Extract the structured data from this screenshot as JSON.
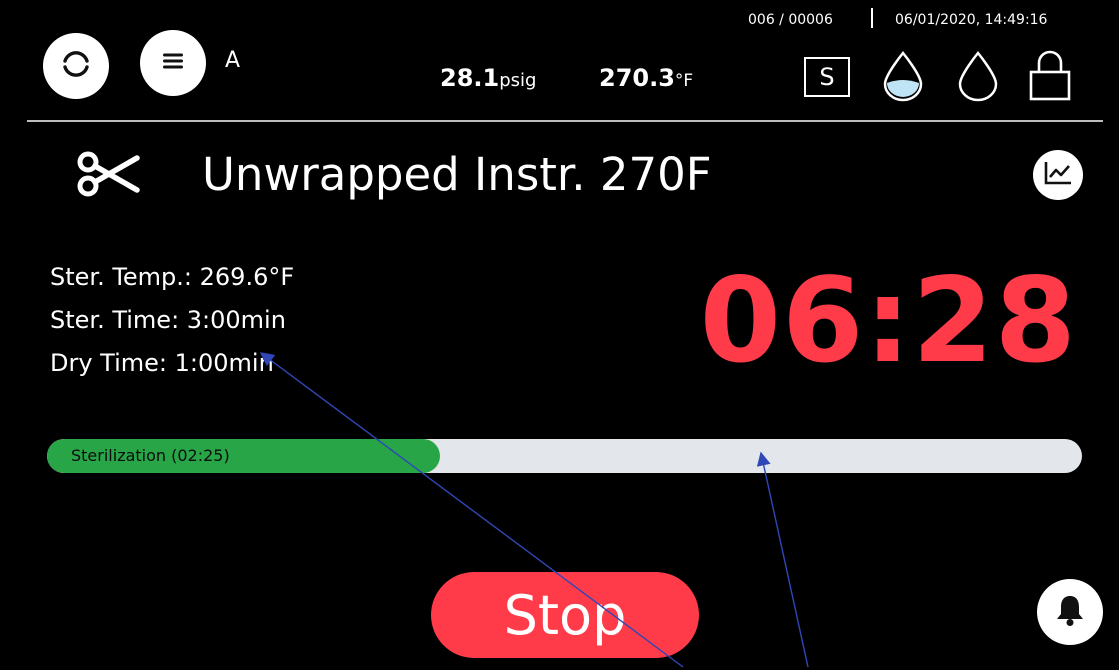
{
  "header": {
    "user_label": "A",
    "pressure_value": "28.1",
    "pressure_unit": "psig",
    "temperature_value": "270.3",
    "temperature_unit": "°F",
    "cycle_counter": "006 / 00006",
    "datetime": "06/01/2020, 14:49:16",
    "status_s_label": "S",
    "icons": {
      "refresh": "refresh-icon",
      "menu": "menu-icon",
      "water_filled": "water-drop-filled-icon",
      "water_empty": "water-drop-empty-icon",
      "lock": "lock-icon"
    }
  },
  "program": {
    "icon": "scissors-icon",
    "title": "Unwrapped Instr. 270F"
  },
  "parameters": {
    "ster_temp": "Ster. Temp.: 269.6°F",
    "ster_time": "Ster. Time: 3:00min",
    "dry_time": "Dry Time: 1:00min"
  },
  "countdown": "06:28",
  "progress": {
    "label": "Sterilization (02:25)",
    "fraction": 0.38
  },
  "actions": {
    "stop_label": "Stop"
  },
  "colors": {
    "background": "#000000",
    "accent_red": "#ff3b4a",
    "progress_green": "#27a547",
    "progress_track": "#e3e6ea",
    "water_fill": "#bfe4f6",
    "annotation_arrow": "#2f47b8"
  }
}
